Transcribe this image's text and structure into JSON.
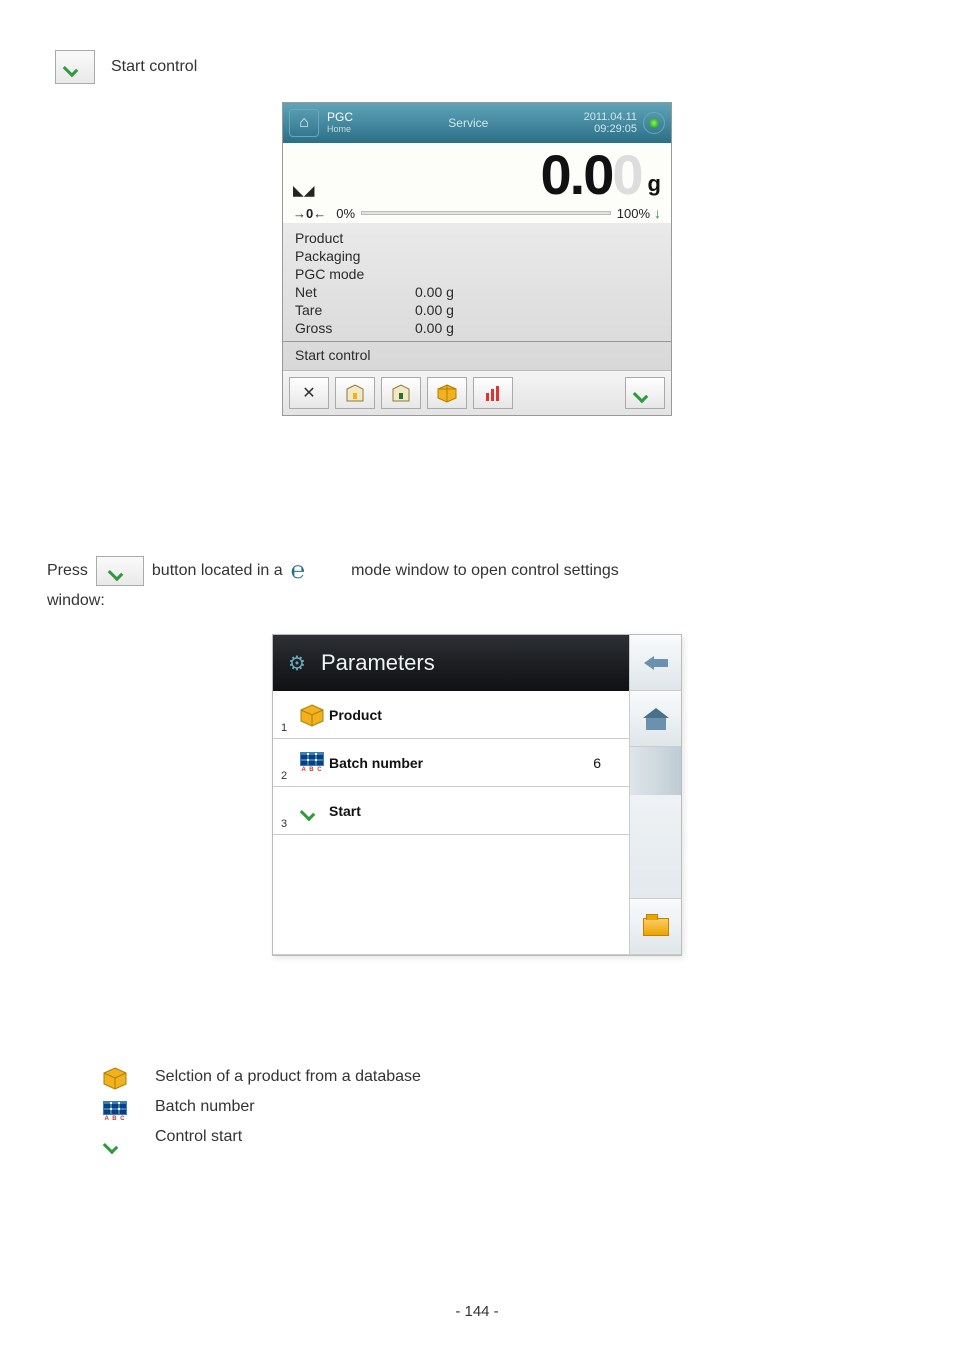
{
  "top": {
    "start_control": "Start control"
  },
  "device1": {
    "header": {
      "title": "PGC",
      "subtitle": "Home",
      "service": "Service",
      "date": "2011.04.11",
      "time": "09:29:05"
    },
    "display": {
      "big_value": "0.0",
      "ghost": "0",
      "unit": "g",
      "zero_symbol": "→0←",
      "left_pct": "0%",
      "right_pct": "100%"
    },
    "rows": {
      "product": "Product",
      "packaging": "Packaging",
      "pgc_mode": "PGC mode",
      "net_label": "Net",
      "net_value": "0.00 g",
      "tare_label": "Tare",
      "tare_value": "0.00 g",
      "gross_label": "Gross",
      "gross_value": "0.00 g",
      "start_control": "Start control"
    }
  },
  "instruction": {
    "press": "Press",
    "middle": "button located in a",
    "tail": "mode window to open control settings",
    "window": "window:"
  },
  "device2": {
    "title": "Parameters",
    "rows": [
      {
        "num": "1",
        "label": "Product",
        "value": ""
      },
      {
        "num": "2",
        "label": "Batch number",
        "value": "6"
      },
      {
        "num": "3",
        "label": "Start",
        "value": ""
      }
    ]
  },
  "legend": {
    "product": "Selction of a product from a database",
    "batch": "Batch number",
    "start": "Control start"
  },
  "page_number": "- 144 -"
}
